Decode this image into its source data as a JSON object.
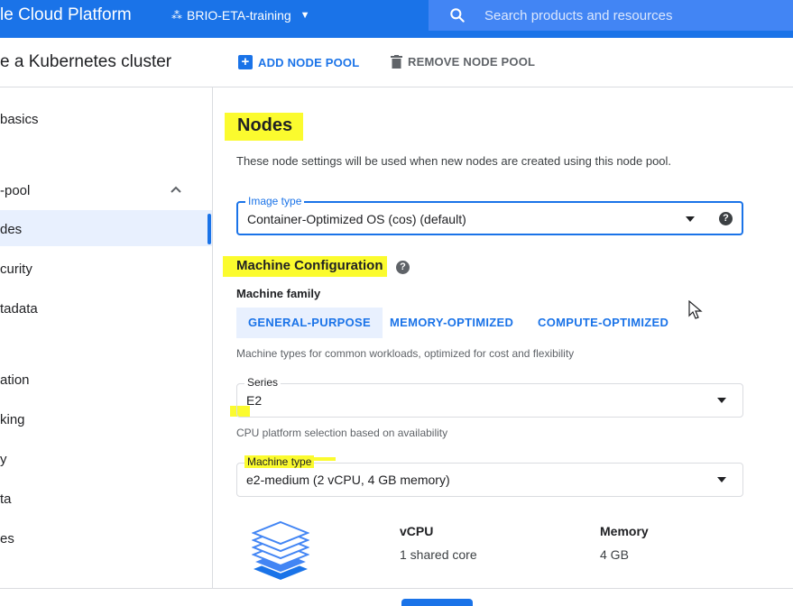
{
  "topbar": {
    "app_title": "le Cloud Platform",
    "project": "BRIO-ETA-training",
    "search_placeholder": "Search products and resources"
  },
  "pagebar": {
    "title": "e a Kubernetes cluster",
    "add_node_pool": "ADD NODE POOL",
    "remove_node_pool": "REMOVE NODE POOL"
  },
  "sidebar": {
    "items": [
      {
        "label": "basics"
      },
      {
        "label": "-pool"
      },
      {
        "label": "des"
      },
      {
        "label": "curity"
      },
      {
        "label": "tadata"
      },
      {
        "label": "ation"
      },
      {
        "label": "king"
      },
      {
        "label": "y"
      },
      {
        "label": "ta"
      },
      {
        "label": "es"
      }
    ],
    "active_index": 2
  },
  "nodes": {
    "title": "Nodes",
    "description": "These node settings will be used when new nodes are created using this node pool.",
    "image_type": {
      "label": "Image type",
      "value": "Container-Optimized OS (cos) (default)"
    }
  },
  "machine_config": {
    "title": "Machine Configuration",
    "family_label": "Machine family",
    "family_tabs": [
      "GENERAL-PURPOSE",
      "MEMORY-OPTIMIZED",
      "COMPUTE-OPTIMIZED"
    ],
    "selected_family": "GENERAL-PURPOSE",
    "family_hint": "Machine types for common workloads, optimized for cost and flexibility",
    "series": {
      "label": "Series",
      "value": "E2"
    },
    "series_hint": "CPU platform selection based on availability",
    "machine_type": {
      "label": "Machine type",
      "value": "e2-medium (2 vCPU, 4 GB memory)"
    },
    "specs": {
      "vcpu_header": "vCPU",
      "vcpu_value": "1 shared core",
      "memory_header": "Memory",
      "memory_value": "4 GB"
    }
  },
  "colors": {
    "primary": "#1a73e8",
    "highlight": "#fbfb2e",
    "selected_tab_bg": "#e8f0fe"
  }
}
